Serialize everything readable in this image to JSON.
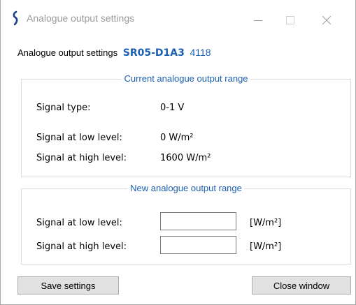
{
  "window": {
    "title": "Analogue output settings",
    "controls": {
      "minimize_icon": "minimize-icon",
      "maximize_icon": "maximize-icon",
      "close_icon": "close-icon"
    }
  },
  "header": {
    "label": "Analogue output settings",
    "model": "SR05-D1A3",
    "serial": "4118"
  },
  "current_range": {
    "title": "Current analogue output range",
    "rows": [
      {
        "label": "Signal type:",
        "value": "0-1 V"
      },
      {
        "label": "Signal at low level:",
        "value": "0 W/m²"
      },
      {
        "label": "Signal at high level:",
        "value": "1600 W/m²"
      }
    ]
  },
  "new_range": {
    "title": "New analogue output range",
    "low": {
      "label": "Signal at low level:",
      "value": "",
      "placeholder": "",
      "unit": "[W/m²]"
    },
    "high": {
      "label": "Signal at high level:",
      "value": "",
      "placeholder": "",
      "unit": "[W/m²]"
    }
  },
  "buttons": {
    "save": "Save settings",
    "close": "Close window"
  },
  "colors": {
    "accent": "#1c5fb0",
    "title_text": "#9a9a9a",
    "button_bg": "#e1e1e1",
    "group_border": "#dcdcdc"
  }
}
